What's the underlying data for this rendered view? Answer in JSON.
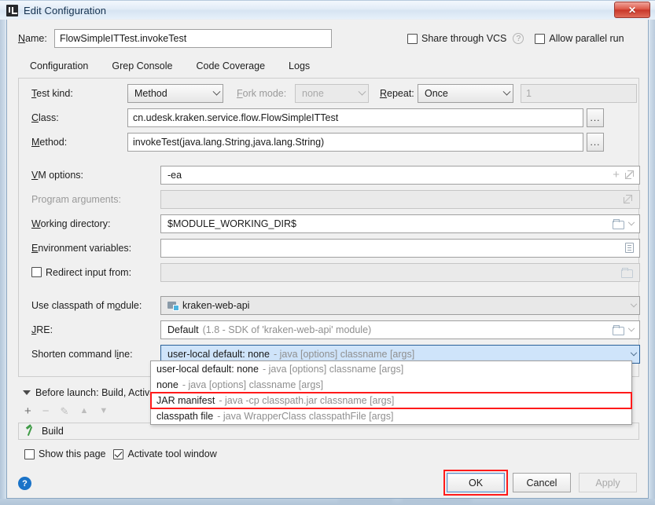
{
  "window": {
    "title": "Edit Configuration",
    "app_icon": "intellij-idea-icon",
    "close_label": "✕"
  },
  "name_row": {
    "label": "Name:",
    "value": "FlowSimpleITTest.invokeTest",
    "placeholder": "",
    "share_vcs_label": "Share through VCS",
    "share_vcs_checked": false,
    "help_glyph": "?",
    "allow_parallel_label": "Allow parallel run",
    "allow_parallel_checked": false
  },
  "tabs": [
    {
      "label": "Configuration",
      "active": true
    },
    {
      "label": "Grep Console",
      "active": false
    },
    {
      "label": "Code Coverage",
      "active": false
    },
    {
      "label": "Logs",
      "active": false
    }
  ],
  "form": {
    "test_kind": {
      "label": "Test kind:",
      "value": "Method"
    },
    "fork_mode": {
      "label": "Fork mode:",
      "value": "none",
      "disabled": true
    },
    "repeat": {
      "label": "Repeat:",
      "value": "Once"
    },
    "repeat_count": {
      "value": "1",
      "disabled": true
    },
    "class": {
      "label": "Class:",
      "value": "cn.udesk.kraken.service.flow.FlowSimpleITTest",
      "browse": "..."
    },
    "method": {
      "label": "Method:",
      "value": "invokeTest(java.lang.String,java.lang.String)",
      "browse": "..."
    },
    "vm_options": {
      "label": "VM options:",
      "value": "-ea"
    },
    "program_arguments": {
      "label": "Program arguments:",
      "value": "",
      "disabled": true
    },
    "working_directory": {
      "label": "Working directory:",
      "value": "$MODULE_WORKING_DIR$"
    },
    "environment_variables": {
      "label": "Environment variables:",
      "value": ""
    },
    "redirect_input": {
      "label": "Redirect input from:",
      "value": "",
      "checked": false,
      "disabled": true
    },
    "use_classpath_of_module": {
      "label": "Use classpath of module:",
      "value": "kraken-web-api",
      "icon": "module-icon"
    },
    "jre": {
      "label": "JRE:",
      "value": "Default",
      "hint": "(1.8 - SDK of 'kraken-web-api' module)"
    },
    "shorten_command_line": {
      "label": "Shorten command line:",
      "value": "user-local default: none",
      "hint": "- java [options] classname [args]"
    }
  },
  "dropdown": {
    "items": [
      {
        "name": "user-local default: none",
        "hint": "- java [options] classname [args]",
        "highlighted": false
      },
      {
        "name": "none",
        "hint": "- java [options] classname [args]",
        "highlighted": false
      },
      {
        "name": "JAR manifest",
        "hint": "- java -cp classpath.jar classname [args]",
        "highlighted": true
      },
      {
        "name": "classpath file",
        "hint": "- java WrapperClass classpathFile [args]",
        "highlighted": false
      }
    ]
  },
  "before_launch": {
    "label": "Before launch: Build, Activa",
    "toolbar": {
      "add": "+",
      "remove": "−",
      "edit": "✎",
      "up": "▲",
      "down": "▼"
    },
    "task": {
      "label": "Build",
      "icon": "build-hammer-icon"
    }
  },
  "bottom": {
    "show_this_page": {
      "label": "Show this page",
      "checked": false
    },
    "activate_tool_window": {
      "label": "Activate tool window",
      "checked": true
    },
    "help_glyph": "?"
  },
  "buttons": {
    "ok": "OK",
    "cancel": "Cancel",
    "apply": "Apply",
    "apply_disabled": true
  },
  "colors": {
    "accent_blue": "#3a83d0",
    "highlight_red": "#ff1a1a",
    "selected_blue_bg": "#cfe4fa",
    "selected_blue_border": "#2a6099",
    "help_blue": "#1a73c8",
    "build_green": "#3f9b46"
  }
}
